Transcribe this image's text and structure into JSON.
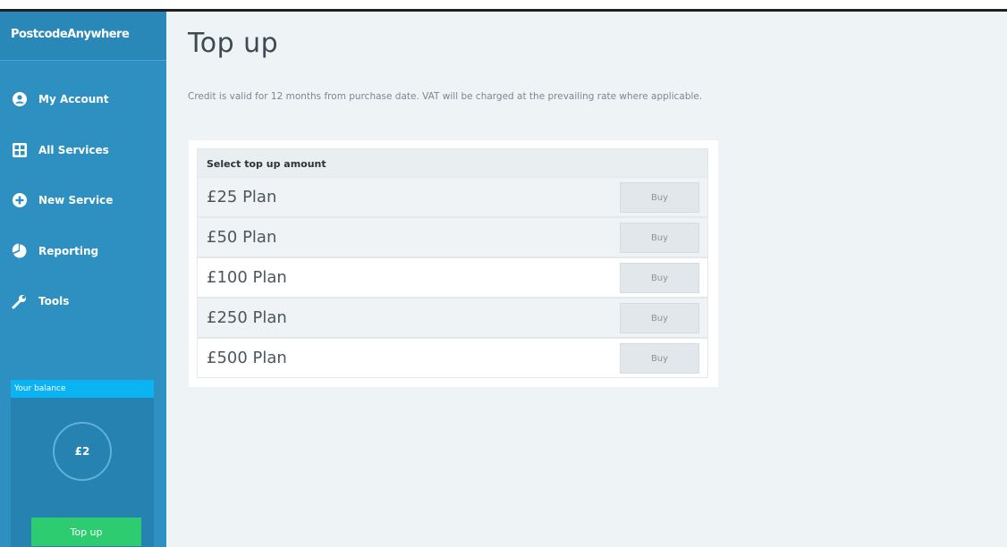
{
  "brand": {
    "name": "PostcodeAnywhere"
  },
  "nav": [
    {
      "label": "My Account",
      "icon": "user-circle-icon"
    },
    {
      "label": "All Services",
      "icon": "grid-icon"
    },
    {
      "label": "New Service",
      "icon": "plus-circle-icon"
    },
    {
      "label": "Reporting",
      "icon": "pie-chart-icon"
    },
    {
      "label": "Tools",
      "icon": "wrench-icon"
    }
  ],
  "balance": {
    "heading": "Your balance",
    "amount": "£2",
    "topup_label": "Top up"
  },
  "page": {
    "title": "Top up",
    "intro": "Credit is valid for 12 months from purchase date. VAT will be charged at the prevailing rate where applicable."
  },
  "plans": {
    "header": "Select top up amount",
    "items": [
      {
        "name": "£25 Plan",
        "buy_label": "Buy"
      },
      {
        "name": "£50 Plan",
        "buy_label": "Buy"
      },
      {
        "name": "£100 Plan",
        "buy_label": "Buy"
      },
      {
        "name": "£250 Plan",
        "buy_label": "Buy"
      },
      {
        "name": "£500 Plan",
        "buy_label": "Buy"
      }
    ]
  },
  "colors": {
    "sidebar": "#2e8fc1",
    "balance_header": "#0bb3f2",
    "topup_button": "#2ecc71",
    "background": "#eef3f6"
  }
}
